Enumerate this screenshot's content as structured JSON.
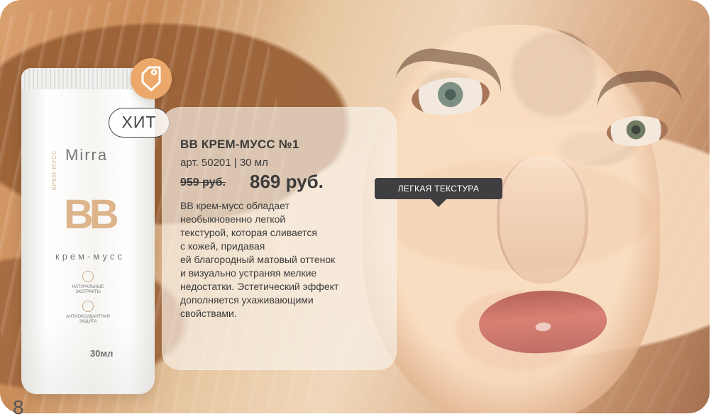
{
  "badge": {
    "hit_label": "ХИТ"
  },
  "product": {
    "brand": "Mirra",
    "logo": "BB",
    "vertical_text": "КРЕМ-МУСС",
    "subtitle": "крем-мусс",
    "features": [
      "НАТУРАЛЬНЫЕ ЭКСТРАКТЫ",
      "АНТИОКСИДАНТНАЯ ЗАЩИТА"
    ],
    "volume": "30мл"
  },
  "info": {
    "title": "BB КРЕМ-МУСС №1",
    "article": "арт. 50201 | 30 мл",
    "old_price": "959 руб.",
    "new_price": "869 руб.",
    "description": "BB крем-мусс обладает\nнеобыкновенно легкой\nтекстурой, которая сливается\nс кожей, придавая\nей благородный матовый оттенок\nи визуально устраняя мелкие\nнедостатки. Эстетический эффект\nдополняется ухаживающими\nсвойствами."
  },
  "tooltip": {
    "label": "ЛЕГКАЯ ТЕКСТУРА"
  },
  "page": {
    "number": "8"
  },
  "colors": {
    "panel_background": "#F8F1E9",
    "tooltip_background": "#3F3F42",
    "text_primary": "#3B3B3B",
    "accent_orange": "#ECA86A",
    "product_beige": "#DEB48B"
  },
  "icons": {
    "tag": "price-tag-icon",
    "feature_1": "leaf-icon",
    "feature_2": "shield-icon",
    "tooltip_pointer": "tooltip-pointer-icon"
  }
}
